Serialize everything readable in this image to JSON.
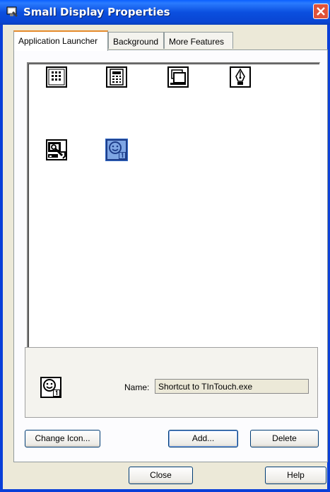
{
  "window": {
    "title": "Small Display Properties"
  },
  "tabs": [
    {
      "label": "Application Launcher",
      "active": true
    },
    {
      "label": "Background",
      "active": false
    },
    {
      "label": "More Features",
      "active": false
    }
  ],
  "apps": [
    {
      "icon": "keypad-icon"
    },
    {
      "icon": "calculator-icon"
    },
    {
      "icon": "window-stack-icon"
    },
    {
      "icon": "pen-nib-icon"
    },
    {
      "icon": "tools-settings-icon"
    },
    {
      "icon": "smiley-shortcut-icon",
      "selected": true
    }
  ],
  "details": {
    "name_label": "Name:",
    "name_value": "Shortcut to TInTouch.exe",
    "preview_icon": "smiley-shortcut-icon"
  },
  "buttons": {
    "change_icon": "Change Icon...",
    "add": "Add...",
    "delete": "Delete",
    "close": "Close",
    "help": "Help"
  },
  "colors": {
    "titlebar": "#0A5FFF",
    "selection": "#3169C6",
    "tab_highlight": "#E68B2C",
    "close_button": "#E0533A"
  }
}
